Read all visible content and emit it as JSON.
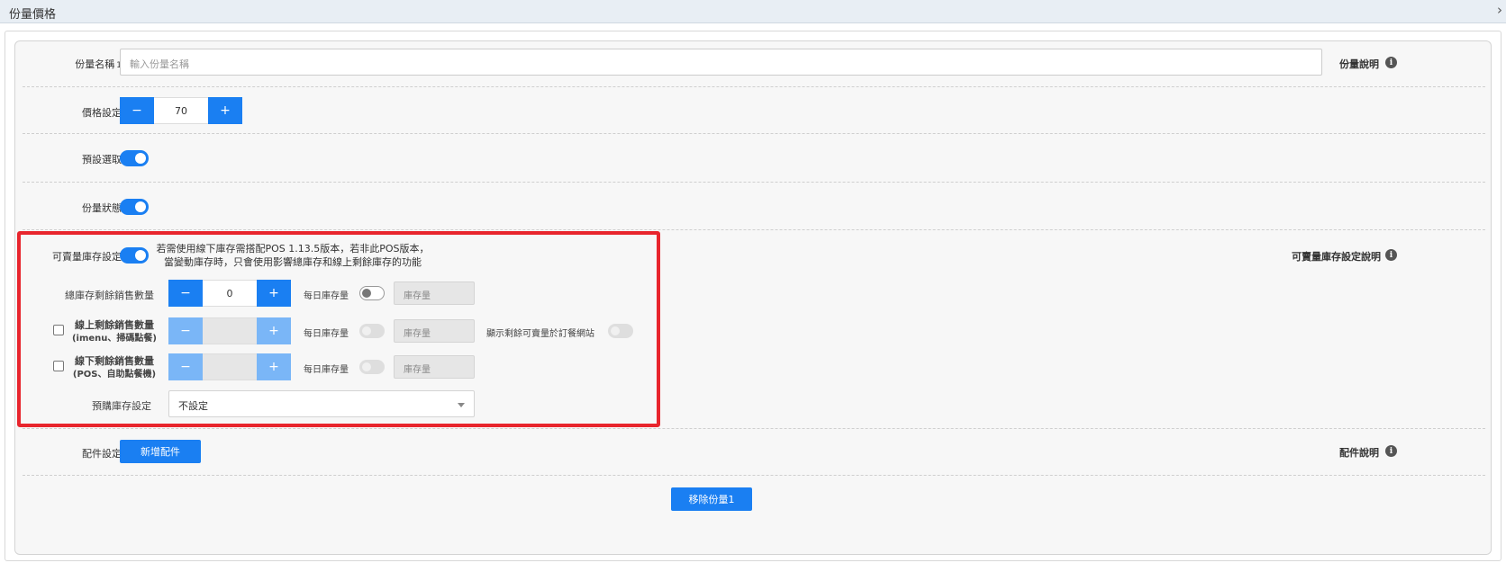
{
  "header": {
    "title": "份量價格",
    "collapse_icon": "chevron-right-icon"
  },
  "portion": {
    "name_label": "份量名稱",
    "name_index": "1",
    "name_placeholder": "輸入份量名稱",
    "name_help": "份量說明",
    "price_label": "價格設定",
    "price_value": "70",
    "minus": "−",
    "plus": "+",
    "default_label": "預設選取",
    "status_label": "份量狀態"
  },
  "inventory": {
    "label": "可賣量庫存設定",
    "note": "若需使用線下庫存需搭配POS 1.13.5版本，若非此POS版本，當變動庫存時，只會使用影響總庫存和線上剩餘庫存的功能",
    "help": "可賣量庫存設定說明",
    "total_label": "總庫存剩餘銷售數量",
    "total_value": "0",
    "daily_label": "每日庫存量",
    "daily_placeholder": "庫存量",
    "online_label_1": "線上剩餘銷售數量",
    "online_label_2": "(imenu、掃碼點餐)",
    "offline_label_1": "線下剩餘銷售數量",
    "offline_label_2": "(POS、自助點餐機)",
    "show_remaining_label": "顯示剩餘可賣量於訂餐網站",
    "preorder_label": "預購庫存設定",
    "preorder_value": "不設定"
  },
  "addon": {
    "label": "配件設定",
    "add_button": "新增配件",
    "help": "配件說明"
  },
  "remove_button": "移除份量1",
  "colors": {
    "primary": "#1a7ff2",
    "highlight": "#e8252d"
  }
}
